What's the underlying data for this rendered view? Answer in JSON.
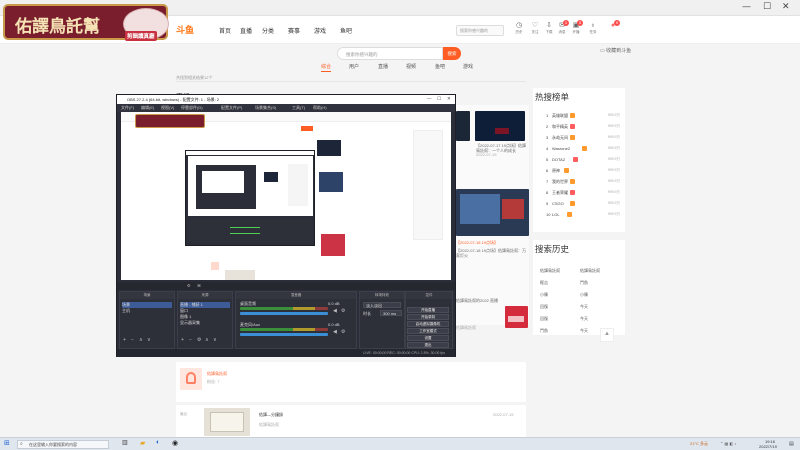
{
  "window": {
    "min": "—",
    "max": "☐",
    "close": "✕"
  },
  "site": {
    "logo": "斗鱼",
    "nav": [
      "首页",
      "直播",
      "分类",
      "赛事",
      "游戏",
      "鱼吧"
    ],
    "header_search_placeholder": "搜索你感兴趣的",
    "header_icons": [
      {
        "icon": "history-icon",
        "label": "历史"
      },
      {
        "icon": "star-icon",
        "label": "关注"
      },
      {
        "icon": "bell-icon",
        "label": "下载"
      },
      {
        "icon": "mail-icon",
        "label": "消息"
      },
      {
        "icon": "broadcast-icon",
        "label": "开播"
      },
      {
        "icon": "gift-icon",
        "label": "任务"
      },
      {
        "icon": "avatar-icon",
        "label": ""
      }
    ],
    "header_badges": [
      "1",
      "3",
      "9"
    ],
    "search_placeholder": "搜索你感兴趣的",
    "search_button": "搜索",
    "favorite": "收藏到斗鱼",
    "tabs": [
      {
        "label": "综合",
        "active": true
      },
      {
        "label": "用户",
        "active": false
      },
      {
        "label": "直播",
        "active": false
      },
      {
        "label": "视频",
        "active": false
      },
      {
        "label": "鱼吧",
        "active": false
      },
      {
        "label": "游戏",
        "active": false
      }
    ],
    "result_info": "共找到相关结果12个",
    "section_live": "直播"
  },
  "hot_list": {
    "title": "热搜榜单",
    "items": [
      {
        "num": "1",
        "name": "英雄联盟",
        "count": "999.9万"
      },
      {
        "num": "2",
        "name": "和平精英",
        "count": "999.9万"
      },
      {
        "num": "3",
        "name": "永劫无间",
        "count": "999.9万"
      },
      {
        "num": "4",
        "name": "Warzone2",
        "count": "999.9万"
      },
      {
        "num": "5",
        "name": "DOTA2",
        "count": "999.9万"
      },
      {
        "num": "6",
        "name": "原神",
        "count": "999.9万"
      },
      {
        "num": "7",
        "name": "我的世界",
        "count": "999.9万"
      },
      {
        "num": "8",
        "name": "王者荣耀",
        "count": "999.9万"
      },
      {
        "num": "9",
        "name": "CSGO",
        "count": "999.9万"
      },
      {
        "num": "10",
        "name": "LOL",
        "count": "999.9万"
      }
    ]
  },
  "history": {
    "title": "搜索历史",
    "items": [
      "佑譯鳥託幫",
      "佑譯鳥託幫",
      "輕吉",
      "鬥魚",
      "小陳",
      "小陳",
      "回復",
      "今天",
      "回復",
      "今天",
      "鬥魚",
      "今天"
    ]
  },
  "results_right": {
    "item1": "【2022-07-17 19点场】佑譯鳥託幫：一个人的成长",
    "item1_meta": "2022-07-19",
    "item2": "【2022-07-18 19点场】佑譯鳥託幫：万家灯火",
    "item2_meta": "【2022-07-18 19点场】",
    "item3": "【2022-07-16 19点场】佑譯鳥託幫",
    "item3_meta": "2022-07-17",
    "item4": "佑譯鳥託幫的2022 直播",
    "item4_meta": "佑譯鳥託幫",
    "bottom_user": "佑譯鳥託幫",
    "bottom_user_meta": "粉丝: 7",
    "bottom_video": "佑譯—分鐘錄",
    "bottom_video_meta": "佑譯鳥託幫",
    "bottom_video_tag": "最近",
    "bottom_video_date": "2022-07-19"
  },
  "obs": {
    "title": "OBS 27.2.4 (64-bit, windows) - 配置文件: 1 - 场景: 2",
    "menu": [
      "文件(F)",
      "编辑(E)",
      "视图(V)",
      "停靠部件(D)",
      "配置文件(P)",
      "场景集合(S)",
      "工具(T)",
      "帮助(H)"
    ],
    "docks": [
      "场景",
      "来源",
      "混音器",
      "转场特效",
      "控件"
    ],
    "scenes": [
      "场景",
      "主机"
    ],
    "sources": [
      "直播 - 捕获 1",
      "窗口",
      "图像 1",
      "显示器采集"
    ],
    "mixer": [
      "桌面音频",
      "麦克风/Aux"
    ],
    "mixer_level": "0.0 dB",
    "transition": {
      "label": "淡入淡出",
      "duration_label": "时长",
      "duration": "300 ms"
    },
    "controls": [
      "开始直播",
      "开始录制",
      "启动虚拟摄像机",
      "工作室模式",
      "设置",
      "退出"
    ],
    "status": "LIVE: 00:00:00   REC: 00:00:00   CPU: 2.5%, 30.00 fps"
  },
  "badge": {
    "text": "佑譯鳥託幫",
    "sub": "剪輯讀真廳"
  },
  "taskbar": {
    "search": "在这里输入你要搜索的内容",
    "weather": "21°C 多云",
    "time": "19:16",
    "date": "2022/7/19"
  }
}
